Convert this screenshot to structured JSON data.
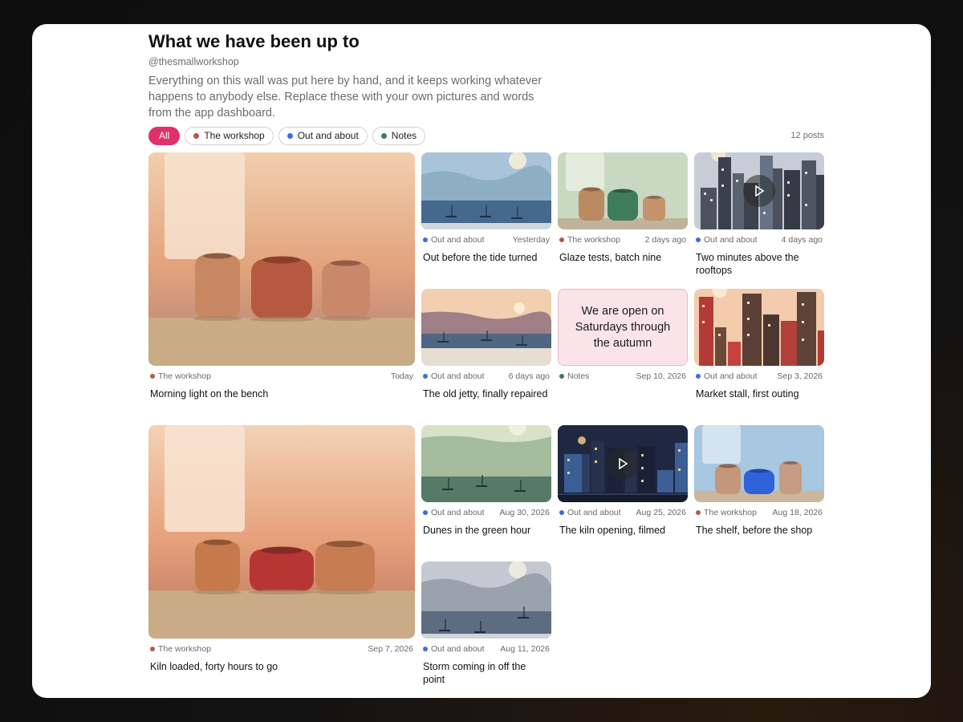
{
  "header": {
    "title": "What we have been up to",
    "handle": "@thesmallworkshop",
    "description": "Everything on this wall was put here by hand, and it keeps working whatever happens to anybody else. Replace these with your own pictures and words from the app dashboard."
  },
  "filters": [
    {
      "label": "All",
      "active": true
    },
    {
      "label": "The workshop",
      "color": "#b65a43"
    },
    {
      "label": "Out and about",
      "color": "#3a6ee0"
    },
    {
      "label": "Notes",
      "color": "#3f7d5a"
    }
  ],
  "post_count": "12 posts",
  "category_colors": {
    "workshop": "#b65a43",
    "outing": "#3a6ee0",
    "notes": "#3f7d5a"
  },
  "posts": [
    {
      "category": "The workshop",
      "date": "Today",
      "title": "Morning light on the bench"
    },
    {
      "category": "Out and about",
      "date": "Yesterday",
      "title": "Out before the tide turned"
    },
    {
      "category": "The workshop",
      "date": "2 days ago",
      "title": "Glaze tests, batch nine"
    },
    {
      "category": "Out and about",
      "date": "4 days ago",
      "title": "Two minutes above the rooftops"
    },
    {
      "category": "Out and about",
      "date": "6 days ago",
      "title": "The old jetty, finally repaired"
    },
    {
      "category": "Notes",
      "date": "Sep 10, 2026",
      "title": "",
      "note_text": "We are open on Saturdays through the autumn"
    },
    {
      "category": "Out and about",
      "date": "Sep 3, 2026",
      "title": "Market stall, first outing"
    },
    {
      "category": "The workshop",
      "date": "Sep 7, 2026",
      "title": "Kiln loaded, forty hours to go"
    },
    {
      "category": "Out and about",
      "date": "Aug 30, 2026",
      "title": "Dunes in the green hour"
    },
    {
      "category": "Out and about",
      "date": "Aug 25, 2026",
      "title": "The kiln opening, filmed"
    },
    {
      "category": "The workshop",
      "date": "Aug 18, 2026",
      "title": "The shelf, before the shop"
    },
    {
      "category": "Out and about",
      "date": "Aug 11, 2026",
      "title": "Storm coming in off the point"
    }
  ]
}
